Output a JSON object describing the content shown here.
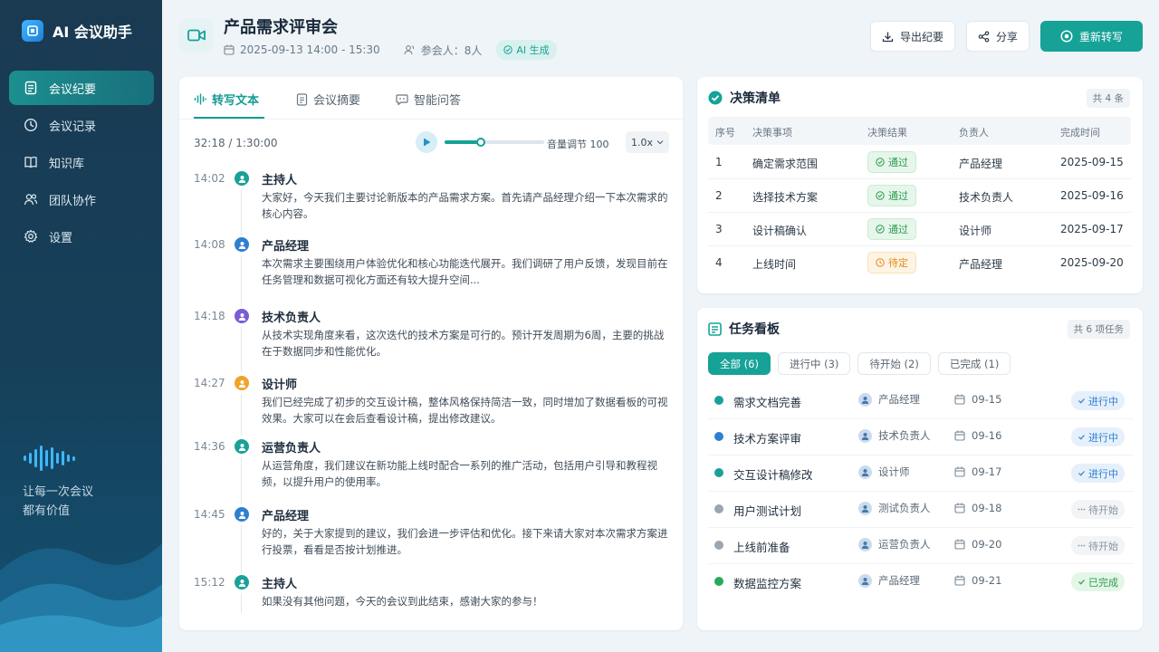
{
  "app": {
    "name": "AI 会议助手"
  },
  "sidebar": {
    "items": [
      {
        "label": "会议纪要",
        "icon": "document-icon",
        "active": true
      },
      {
        "label": "会议记录",
        "icon": "clock-icon"
      },
      {
        "label": "知识库",
        "icon": "book-icon"
      },
      {
        "label": "团队协作",
        "icon": "team-icon"
      },
      {
        "label": "设置",
        "icon": "gear-icon"
      }
    ],
    "slogan_line1": "让每一次会议",
    "slogan_line2": "都有价值"
  },
  "header": {
    "title": "产品需求评审会",
    "datetime": "2025-09-13 14:00 - 15:30",
    "participants": "参会人：8人",
    "ai_badge": "AI 生成",
    "export_label": "导出纪要",
    "share_label": "分享",
    "retranscribe_label": "重新转写"
  },
  "tabs": [
    {
      "label": "转写文本",
      "active": true
    },
    {
      "label": "会议摘要"
    },
    {
      "label": "智能问答"
    }
  ],
  "player": {
    "current": "32:18",
    "total": "1:30:00",
    "time_display": "32:18 / 1:30:00",
    "progress": 0.36,
    "volume_label": "音量调节 100",
    "speed": "1.0x"
  },
  "transcript": [
    {
      "time": "14:02",
      "speaker": "主持人",
      "color": "#1aa197",
      "text": "大家好，今天我们主要讨论新版本的产品需求方案。首先请产品经理介绍一下本次需求的核心内容。"
    },
    {
      "time": "14:08",
      "speaker": "产品经理",
      "color": "#2f7fd0",
      "text": "本次需求主要围绕用户体验优化和核心功能迭代展开。我们调研了用户反馈，发现目前在任务管理和数据可视化方面还有较大提升空间..."
    },
    {
      "time": "14:18",
      "speaker": "技术负责人",
      "color": "#7b5bd6",
      "text": "从技术实现角度来看，这次迭代的技术方案是可行的。预计开发周期为6周，主要的挑战在于数据同步和性能优化。"
    },
    {
      "time": "14:27",
      "speaker": "设计师",
      "color": "#f0a32a",
      "text": "我们已经完成了初步的交互设计稿，整体风格保持简洁一致，同时增加了数据看板的可视效果。大家可以在会后查看设计稿，提出修改建议。"
    },
    {
      "time": "14:36",
      "speaker": "运营负责人",
      "color": "#1aa197",
      "text": "从运营角度，我们建议在新功能上线时配合一系列的推广活动，包括用户引导和教程视频，以提升用户的使用率。"
    },
    {
      "time": "14:45",
      "speaker": "产品经理",
      "color": "#2f7fd0",
      "text": "好的，关于大家提到的建议，我们会进一步评估和优化。接下来请大家对本次需求方案进行投票，看看是否按计划推进。"
    },
    {
      "time": "15:12",
      "speaker": "主持人",
      "color": "#1aa197",
      "text": "如果没有其他问题，今天的会议到此结束，感谢大家的参与！"
    }
  ],
  "decisions": {
    "title": "决策清单",
    "count": "共 4 条",
    "columns": [
      "序号",
      "决策事项",
      "决策结果",
      "负责人",
      "完成时间"
    ],
    "rows": [
      {
        "no": "1",
        "item": "确定需求范围",
        "result": "通过",
        "status": "pass",
        "owner": "产品经理",
        "date": "2025-09-15"
      },
      {
        "no": "2",
        "item": "选择技术方案",
        "result": "通过",
        "status": "pass",
        "owner": "技术负责人",
        "date": "2025-09-16"
      },
      {
        "no": "3",
        "item": "设计稿确认",
        "result": "通过",
        "status": "pass",
        "owner": "设计师",
        "date": "2025-09-17"
      },
      {
        "no": "4",
        "item": "上线时间",
        "result": "待定",
        "status": "pending",
        "owner": "产品经理",
        "date": "2025-09-20"
      }
    ]
  },
  "tasks": {
    "title": "任务看板",
    "count": "共 6 项任务",
    "filters": [
      {
        "label": "全部 (6)",
        "active": true
      },
      {
        "label": "进行中 (3)"
      },
      {
        "label": "待开始 (2)"
      },
      {
        "label": "已完成 (1)"
      }
    ],
    "rows": [
      {
        "name": "需求文档完善",
        "owner": "产品经理",
        "date": "09-15",
        "status": "进行中",
        "kind": "progress",
        "dot": "#1aa197"
      },
      {
        "name": "技术方案评审",
        "owner": "技术负责人",
        "date": "09-16",
        "status": "进行中",
        "kind": "progress",
        "dot": "#2f7fd0"
      },
      {
        "name": "交互设计稿修改",
        "owner": "设计师",
        "date": "09-17",
        "status": "进行中",
        "kind": "progress",
        "dot": "#1aa197"
      },
      {
        "name": "用户测试计划",
        "owner": "测试负责人",
        "date": "09-18",
        "status": "待开始",
        "kind": "todo",
        "dot": "#9aa6b2"
      },
      {
        "name": "上线前准备",
        "owner": "运营负责人",
        "date": "09-20",
        "status": "待开始",
        "kind": "todo",
        "dot": "#9aa6b2"
      },
      {
        "name": "数据监控方案",
        "owner": "产品经理",
        "date": "09-21",
        "status": "已完成",
        "kind": "done",
        "dot": "#2aa75a"
      }
    ]
  },
  "colors": {
    "accent": "#16a297",
    "sidebar": "#1a3a52",
    "progress": "#2f7fd0",
    "done": "#2a9d4e",
    "pending": "#e08a1e"
  }
}
